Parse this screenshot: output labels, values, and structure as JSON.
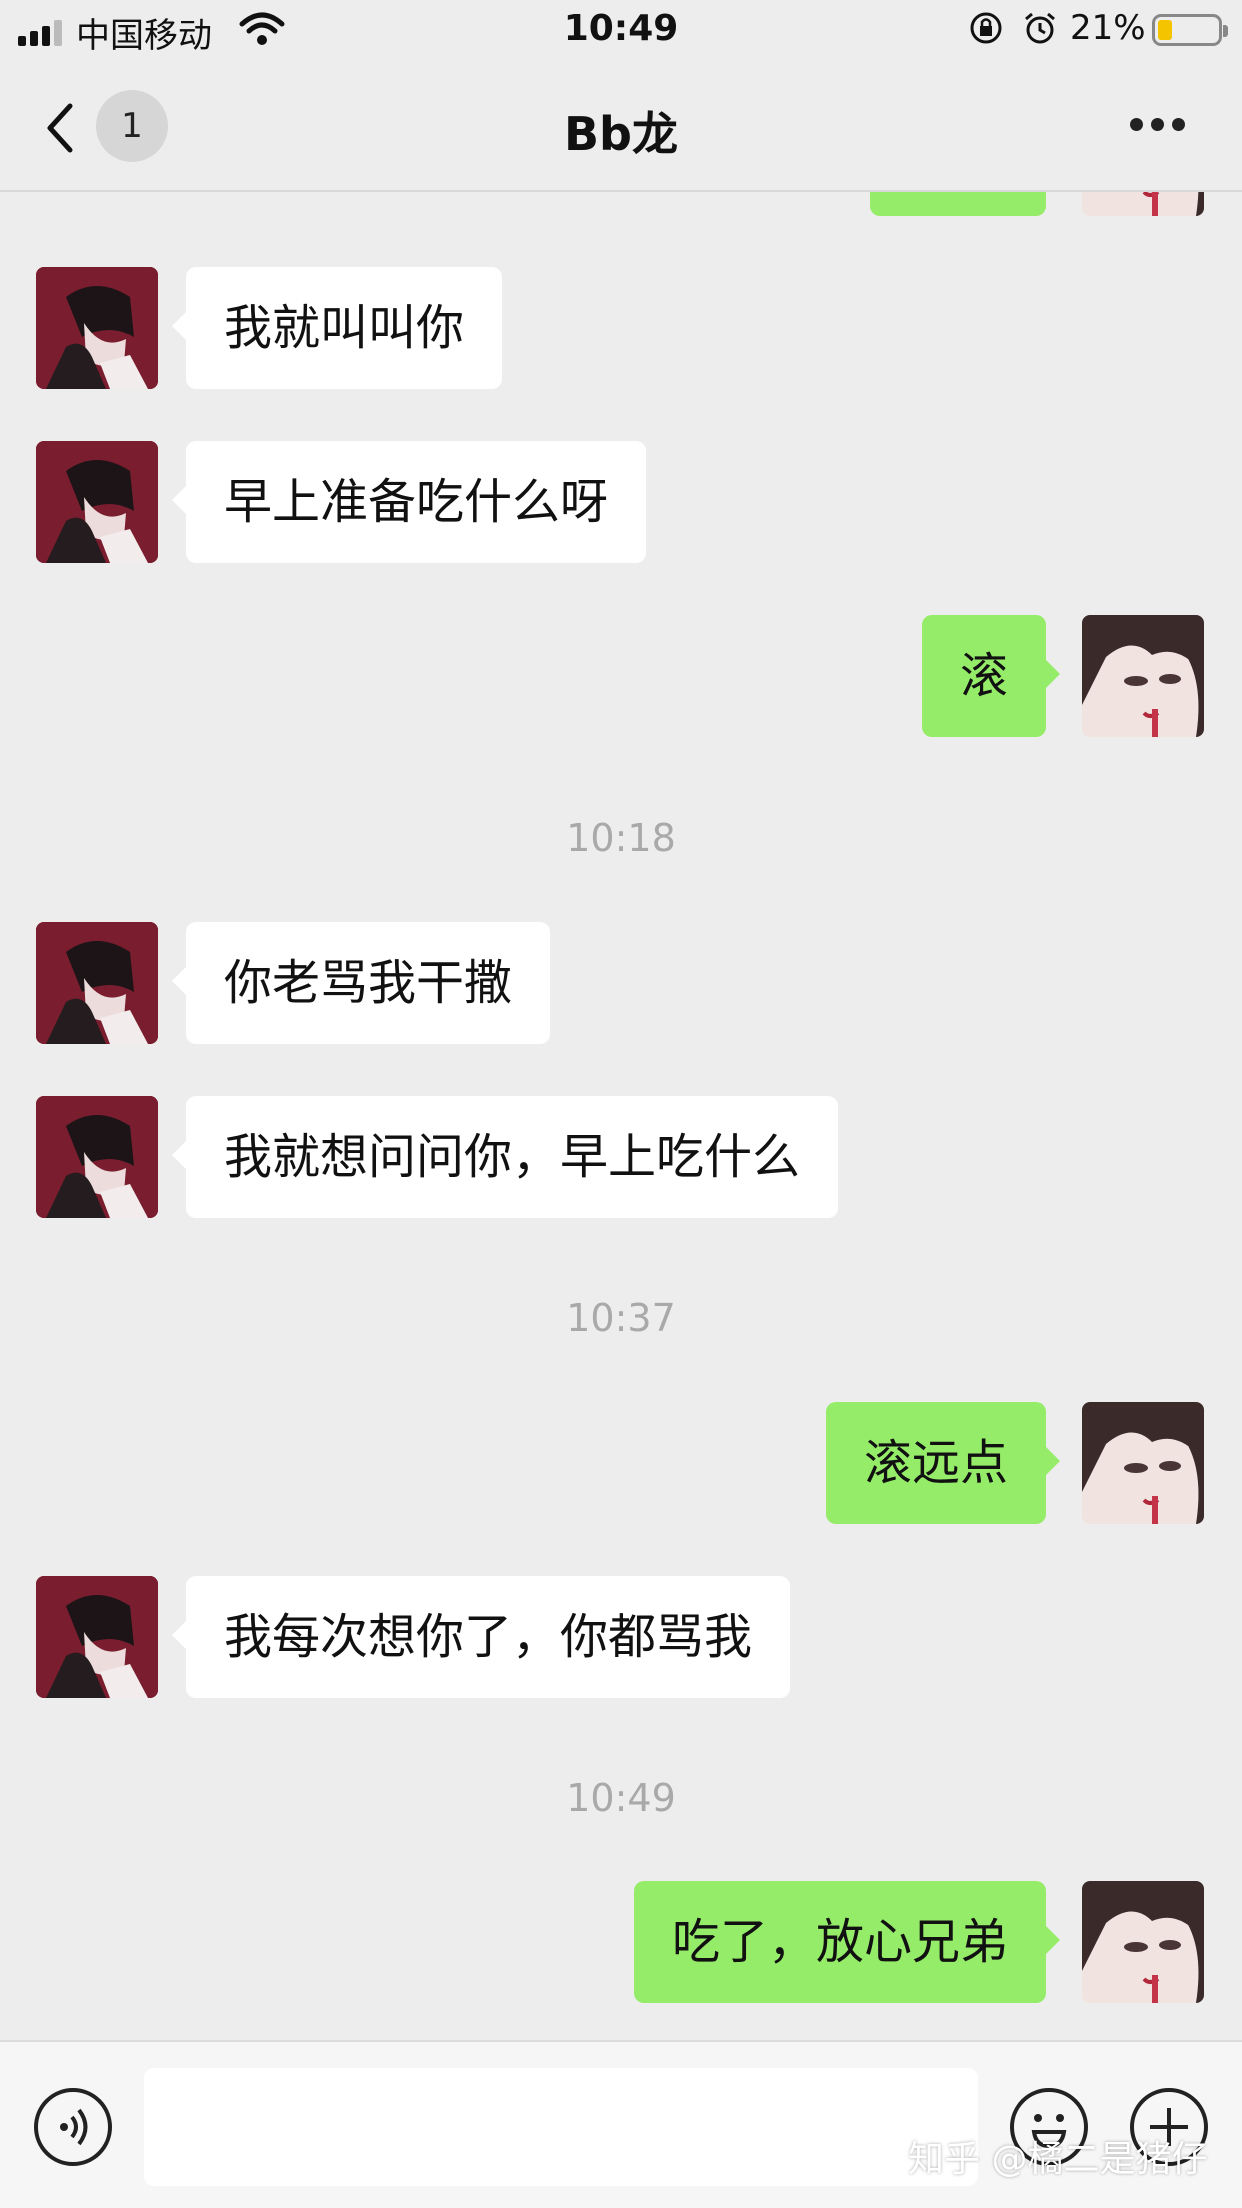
{
  "status_bar": {
    "carrier": "中国移动",
    "time": "10:49",
    "battery": "21%"
  },
  "nav": {
    "unread_count": "1",
    "title": "Bb龙"
  },
  "messages": [
    {
      "side": "in",
      "text": "我就叫叫你"
    },
    {
      "side": "in",
      "text": "早上准备吃什么呀"
    },
    {
      "side": "out",
      "text": "滚"
    },
    {
      "timestamp": "10:18"
    },
    {
      "side": "in",
      "text": "你老骂我干撒"
    },
    {
      "side": "in",
      "text": "我就想问问你，早上吃什么"
    },
    {
      "timestamp": "10:37"
    },
    {
      "side": "out",
      "text": "滚远点"
    },
    {
      "side": "in",
      "text": "我每次想你了，你都骂我"
    },
    {
      "timestamp": "10:49"
    },
    {
      "side": "out",
      "text": "吃了，放心兄弟"
    }
  ],
  "input_bar": {
    "text_value": ""
  },
  "watermark": "知乎 @橘二是猪仔",
  "colors": {
    "background": "#ededed",
    "outgoing_bubble": "#95ec69",
    "incoming_bubble": "#ffffff",
    "timestamp_text": "#a9a9a9"
  }
}
